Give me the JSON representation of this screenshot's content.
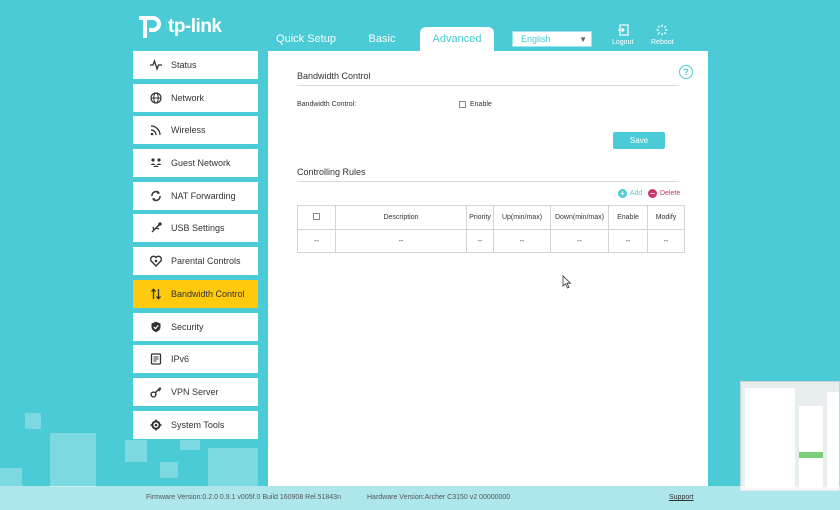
{
  "header": {
    "logo_text": "tp-link",
    "tabs": [
      {
        "label": "Quick Setup"
      },
      {
        "label": "Basic"
      },
      {
        "label": "Advanced"
      }
    ],
    "language": "English",
    "logout_label": "Logout",
    "reboot_label": "Reboot"
  },
  "sidebar": {
    "items": [
      {
        "label": "Status",
        "icon": "pulse-icon"
      },
      {
        "label": "Network",
        "icon": "globe-icon"
      },
      {
        "label": "Wireless",
        "icon": "wifi-icon"
      },
      {
        "label": "Guest Network",
        "icon": "guest-icon"
      },
      {
        "label": "NAT Forwarding",
        "icon": "nat-icon"
      },
      {
        "label": "USB Settings",
        "icon": "usb-icon"
      },
      {
        "label": "Parental Controls",
        "icon": "heart-icon"
      },
      {
        "label": "Bandwidth Control",
        "icon": "updown-arrows-icon"
      },
      {
        "label": "Security",
        "icon": "shield-icon"
      },
      {
        "label": "IPv6",
        "icon": "ipv6-icon"
      },
      {
        "label": "VPN Server",
        "icon": "key-icon"
      },
      {
        "label": "System Tools",
        "icon": "gear-icon"
      }
    ]
  },
  "main": {
    "section1_title": "Bandwidth Control",
    "bandwidth_label": "Bandwidth Control:",
    "enable_label": "Enable",
    "save_label": "Save",
    "section2_title": "Controlling Rules",
    "add_label": "Add",
    "delete_label": "Delete",
    "table": {
      "headers": [
        "Description",
        "Priority",
        "Up(min/max)",
        "Down(min/max)",
        "Enable",
        "Modify"
      ],
      "row": [
        "--",
        "--",
        "--",
        "--",
        "--",
        "--",
        "--"
      ]
    },
    "help_symbol": "?"
  },
  "footer": {
    "firmware": "Firmware Version:0.2.0 0.9.1 v005f.0 Build 160908 Rel.51843n",
    "hardware": "Hardware Version:Archer C3150 v2 00000000",
    "support": "Support"
  },
  "colors": {
    "accent": "#4acbd6",
    "active": "#ffc90e",
    "delete": "#c8346b"
  }
}
